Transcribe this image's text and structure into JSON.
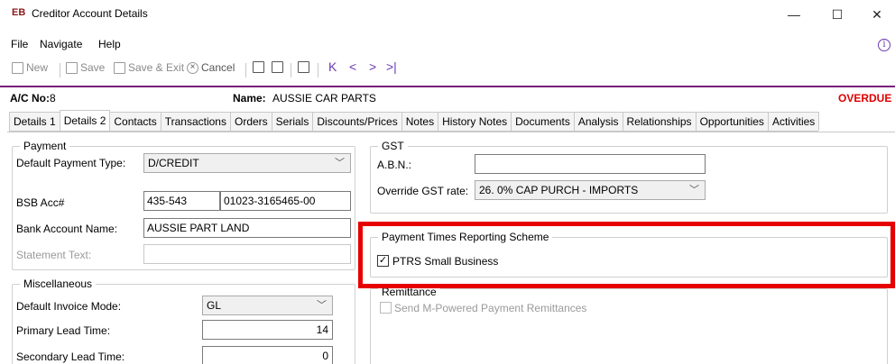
{
  "window": {
    "badge": "EB",
    "title": "Creditor Account Details",
    "minimize": "—",
    "maximize": "☐",
    "close": "✕"
  },
  "menu": {
    "file": "File",
    "navigate": "Navigate",
    "help": "Help",
    "info_icon": "i"
  },
  "toolbar": {
    "new": "New",
    "save": "Save",
    "save_exit": "Save & Exit",
    "cancel": "Cancel",
    "first": "K",
    "prev": "<",
    "next": ">",
    "last": ">|"
  },
  "account": {
    "ac_label": "A/C No:",
    "ac_value": "8",
    "name_label": "Name:",
    "name_value": "AUSSIE CAR PARTS",
    "status": "OVERDUE",
    "status_color": "#e00000"
  },
  "tabs": [
    "Details 1",
    "Details 2",
    "Contacts",
    "Transactions",
    "Orders",
    "Serials",
    "Discounts/Prices",
    "Notes",
    "History Notes",
    "Documents",
    "Analysis",
    "Relationships",
    "Opportunities",
    "Activities"
  ],
  "active_tab": "Details 2",
  "payment": {
    "title": "Payment",
    "default_payment_type_label": "Default Payment Type:",
    "default_payment_type_value": "D/CREDIT",
    "bsb_label": "BSB Acc#",
    "bsb_value": "435-543",
    "account_number_value": "01023-3165465-00",
    "bank_account_name_label": "Bank Account Name:",
    "bank_account_name_value": "AUSSIE PART LAND",
    "statement_text_label": "Statement Text:",
    "statement_text_value": ""
  },
  "misc": {
    "title": "Miscellaneous",
    "default_invoice_mode_label": "Default Invoice Mode:",
    "default_invoice_mode_value": "GL",
    "primary_lead_time_label": "Primary Lead Time:",
    "primary_lead_time_value": "14",
    "secondary_lead_time_label": "Secondary Lead Time:",
    "secondary_lead_time_value": "0"
  },
  "gst": {
    "title": "GST",
    "abn_label": "A.B.N.:",
    "abn_value": "",
    "override_label": "Override GST rate:",
    "override_value": "26. 0% CAP PURCH - IMPORTS"
  },
  "ptrs": {
    "title": "Payment Times Reporting Scheme",
    "checkbox_label": "PTRS Small Business",
    "checked": true,
    "highlight_color": "#e60000"
  },
  "remittance": {
    "title": "Remittance",
    "checkbox_label": "Send M-Powered Payment Remittances",
    "checked": false
  }
}
